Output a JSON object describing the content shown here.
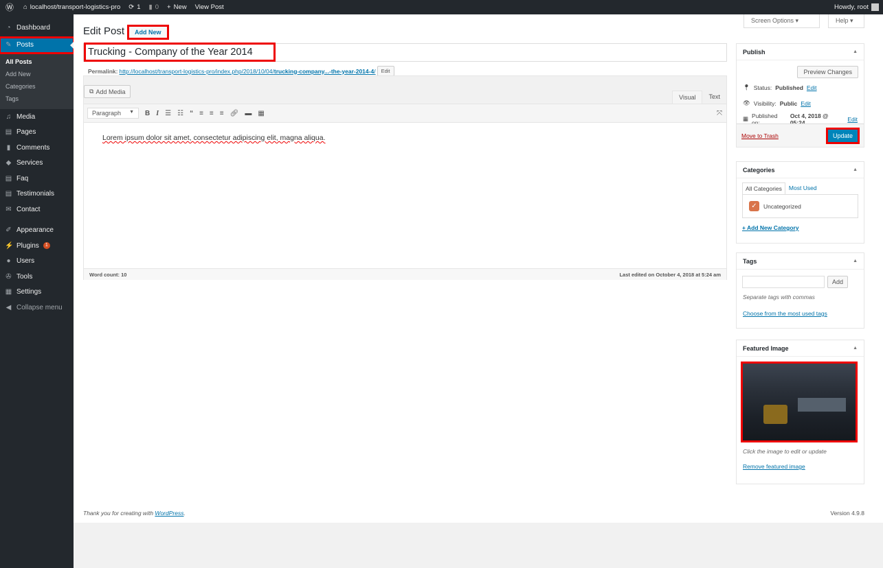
{
  "adminbar": {
    "site": "localhost/transport-logistics-pro",
    "updates": "1",
    "comments": "0",
    "new": "New",
    "view": "View Post",
    "howdy": "Howdy, root"
  },
  "sidebar": {
    "items": [
      {
        "label": "Dashboard",
        "icon": "dashboard-icon"
      },
      {
        "label": "Posts",
        "icon": "pin-icon"
      },
      {
        "label": "Media",
        "icon": "media-icon"
      },
      {
        "label": "Pages",
        "icon": "pages-icon"
      },
      {
        "label": "Comments",
        "icon": "comment-icon"
      },
      {
        "label": "Services",
        "icon": "tag-icon"
      },
      {
        "label": "Faq",
        "icon": "faq-icon"
      },
      {
        "label": "Testimonials",
        "icon": "testimonial-icon"
      },
      {
        "label": "Contact",
        "icon": "mail-icon"
      },
      {
        "label": "Appearance",
        "icon": "brush-icon"
      },
      {
        "label": "Plugins",
        "icon": "plugin-icon",
        "badge": "1"
      },
      {
        "label": "Users",
        "icon": "user-icon"
      },
      {
        "label": "Tools",
        "icon": "wrench-icon"
      },
      {
        "label": "Settings",
        "icon": "settings-icon"
      },
      {
        "label": "Collapse menu",
        "icon": "collapse-icon"
      }
    ],
    "submenu": [
      "All Posts",
      "Add New",
      "Categories",
      "Tags"
    ]
  },
  "header": {
    "screen_options": "Screen Options ▾",
    "help": "Help ▾",
    "title": "Edit Post",
    "add_new": "Add New"
  },
  "post": {
    "title": "Trucking - Company of the Year 2014",
    "permalink_label": "Permalink:",
    "permalink_base": "http://localhost/transport-logistics-pro/index.php/2018/10/04/",
    "permalink_slug": "trucking-company...-the-year-2014-4",
    "permalink_end": "/",
    "edit": "Edit"
  },
  "editor": {
    "add_media": "Add Media",
    "tab_visual": "Visual",
    "tab_text": "Text",
    "format": "Paragraph",
    "content": "Lorem ipsum dolor sit amet, consectetur adipiscing elit, magna aliqua.",
    "word_count": "Word count: 10",
    "last_edited": "Last edited on October 4, 2018 at 5:24 am"
  },
  "publish": {
    "title": "Publish",
    "preview": "Preview Changes",
    "status_label": "Status:",
    "status": "Published",
    "visibility_label": "Visibility:",
    "visibility": "Public",
    "published_label": "Published on:",
    "published": "Oct 4, 2018 @ 05:24",
    "edit": "Edit",
    "trash": "Move to Trash",
    "update": "Update"
  },
  "categories": {
    "title": "Categories",
    "tab_all": "All Categories",
    "tab_used": "Most Used",
    "items": [
      {
        "label": "Uncategorized",
        "checked": true
      }
    ],
    "add": "+ Add New Category"
  },
  "tags": {
    "title": "Tags",
    "add": "Add",
    "hint": "Separate tags with commas",
    "choose": "Choose from the most used tags"
  },
  "featured": {
    "title": "Featured Image",
    "hint": "Click the image to edit or update",
    "remove": "Remove featured image"
  },
  "footer": {
    "thanks": "Thank you for creating with ",
    "wp": "WordPress",
    "dot": ".",
    "version": "Version 4.9.8"
  },
  "colors": {
    "accent": "#0073aa",
    "adminbar": "#23282d",
    "highlight": "#ee0000"
  }
}
